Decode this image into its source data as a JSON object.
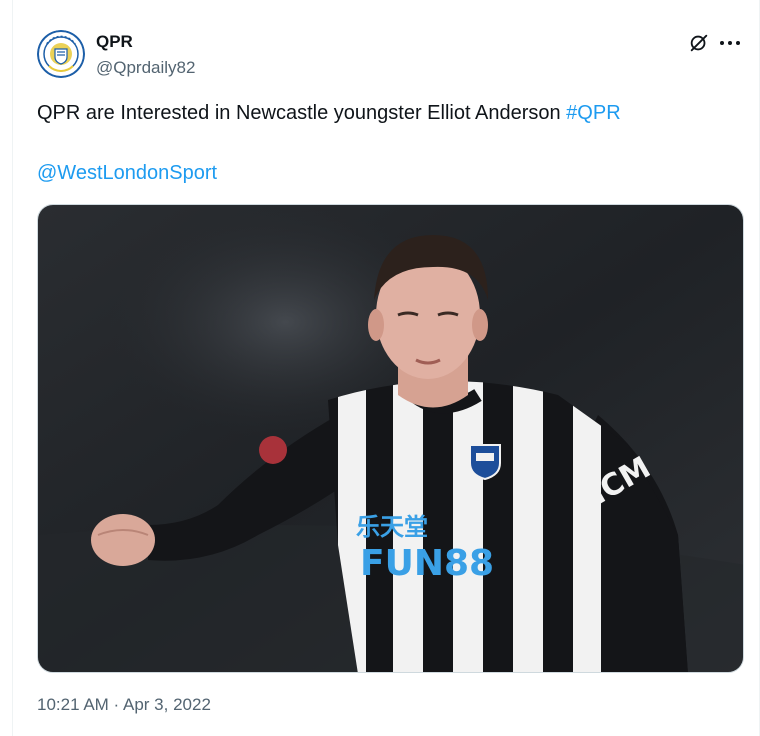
{
  "user": {
    "display_name": "QPR",
    "handle": "@Qprdaily82",
    "avatar_icon": "qpr-crest-icon"
  },
  "tweet": {
    "text": "QPR are Interested in Newcastle youngster Elliot Anderson ",
    "hashtag": "#QPR",
    "mention": "@WestLondonSport"
  },
  "media": {
    "kit_sponsor": "FUN88",
    "kit_sponsor_chinese": "乐天堂",
    "sleeve_text": "ICM"
  },
  "meta": {
    "time": "10:21 AM",
    "separator": " · ",
    "date": "Apr 3, 2022"
  },
  "icons": {
    "grok": "grok-icon",
    "more": "more-options-icon"
  },
  "colors": {
    "link": "#1d9bf0",
    "secondary_text": "#536471",
    "primary_text": "#0f1419"
  }
}
